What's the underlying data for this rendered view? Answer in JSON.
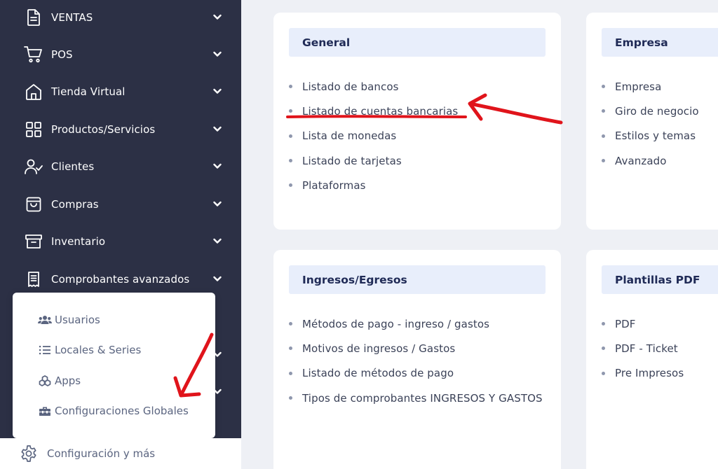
{
  "sidebar": {
    "items": [
      {
        "label": "VENTAS",
        "icon": "document-icon"
      },
      {
        "label": "POS",
        "icon": "cart-icon"
      },
      {
        "label": "Tienda Virtual",
        "icon": "home-icon"
      },
      {
        "label": "Productos/Servicios",
        "icon": "grid-icon"
      },
      {
        "label": "Clientes",
        "icon": "user-check-icon"
      },
      {
        "label": "Compras",
        "icon": "shopping-bag-icon"
      },
      {
        "label": "Inventario",
        "icon": "archive-icon"
      },
      {
        "label": "Comprobantes avanzados",
        "icon": "receipt-icon"
      }
    ],
    "dropdown": {
      "items": [
        {
          "label": "Usuarios",
          "icon": "users-icon"
        },
        {
          "label": "Locales & Series",
          "icon": "list-icon"
        },
        {
          "label": "Apps",
          "icon": "cubes-icon"
        },
        {
          "label": "Configuraciones Globales",
          "icon": "toolbox-icon"
        }
      ]
    },
    "footer": {
      "label": "Configuración y más",
      "icon": "gear-icon"
    }
  },
  "cards": {
    "general": {
      "title": "General",
      "items": [
        "Listado de bancos",
        "Listado de cuentas bancarias",
        "Lista de monedas",
        "Listado de tarjetas",
        "Plataformas"
      ]
    },
    "empresa": {
      "title": "Empresa",
      "items": [
        "Empresa",
        "Giro de negocio",
        "Estilos y temas",
        "Avanzado"
      ]
    },
    "ingresos": {
      "title": "Ingresos/Egresos",
      "items": [
        "Métodos de pago - ingreso / gastos",
        "Motivos de ingresos / Gastos",
        "Listado de métodos de pago",
        "Tipos de comprobantes INGRESOS Y GASTOS"
      ]
    },
    "plantillas": {
      "title": "Plantillas PDF",
      "items": [
        "PDF",
        "PDF - Ticket",
        "Pre Impresos"
      ]
    }
  },
  "colors": {
    "sidebar_bg": "#2c3045",
    "card_header_bg": "#e8eefb",
    "card_title": "#1f2a56",
    "annotation_red": "#e0141b"
  }
}
